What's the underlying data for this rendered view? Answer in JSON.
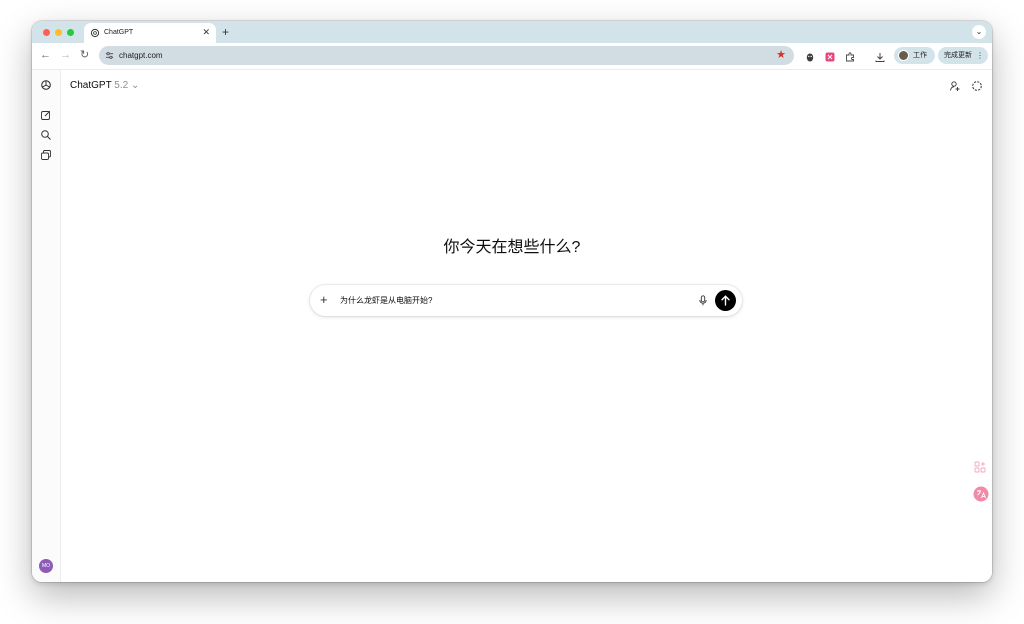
{
  "browser": {
    "tab": {
      "title": "ChatGPT",
      "close": "✕"
    },
    "new_tab": "+",
    "tab_menu": "⌄",
    "nav": {
      "back": "←",
      "forward": "→",
      "reload": "↻"
    },
    "address": {
      "url": "chatgpt.com",
      "bookmark": "★"
    },
    "profile": {
      "label": "工作"
    },
    "update": {
      "label": "完成更新",
      "menu": "⋮"
    }
  },
  "app": {
    "model": {
      "name": "ChatGPT",
      "version": "5.2",
      "chevron": "⌄"
    },
    "heading": "你今天在想些什么?",
    "composer": {
      "plus": "+",
      "value": "为什么龙虾是从电脑开始?"
    },
    "user": {
      "initials": "MO"
    }
  },
  "colors": {
    "accent": "#000000",
    "tabbar": "#d3e3ea",
    "omnibox": "#d2dde3",
    "avatar": "#8e5bb8",
    "star": "#d93025"
  },
  "icons": [
    "chatgpt-logo-icon",
    "new-chat-icon",
    "search-icon",
    "library-icon",
    "share-icon",
    "temporary-chat-icon",
    "mic-icon",
    "arrow-up-icon",
    "translate-icon",
    "grid-icon"
  ]
}
